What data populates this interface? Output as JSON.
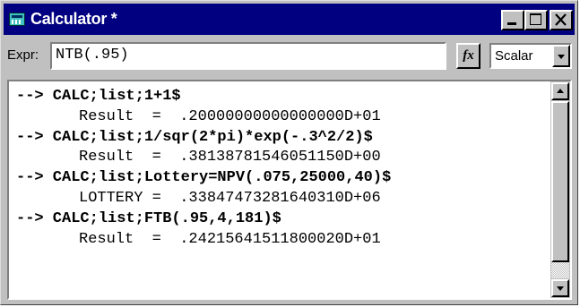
{
  "window": {
    "title": "Calculator *",
    "controls": [
      "minimize-icon",
      "maximize-icon",
      "close-icon"
    ]
  },
  "expression": {
    "label": "Expr:",
    "value": "NTB(.95)",
    "fx_label": "fx",
    "mode": "Scalar"
  },
  "output": {
    "lines": [
      {
        "kind": "cmd",
        "text": "--> CALC;list;1+1$"
      },
      {
        "kind": "res",
        "text": "Result  =  .20000000000000000D+01"
      },
      {
        "kind": "cmd",
        "text": "--> CALC;list;1/sqr(2*pi)*exp(-.3^2/2)$"
      },
      {
        "kind": "res",
        "text": "Result  =  .38138781546051150D+00"
      },
      {
        "kind": "cmd",
        "text": "--> CALC;list;Lottery=NPV(.075,25000,40)$"
      },
      {
        "kind": "res",
        "text": "LOTTERY =  .33847473281640310D+06"
      },
      {
        "kind": "cmd",
        "text": "--> CALC;list;FTB(.95,4,181)$"
      },
      {
        "kind": "res",
        "text": "Result  =  .24215641511800020D+01"
      }
    ]
  },
  "colors": {
    "titlebar": "#000080",
    "face": "#c0c0c0",
    "field": "#ffffff"
  }
}
